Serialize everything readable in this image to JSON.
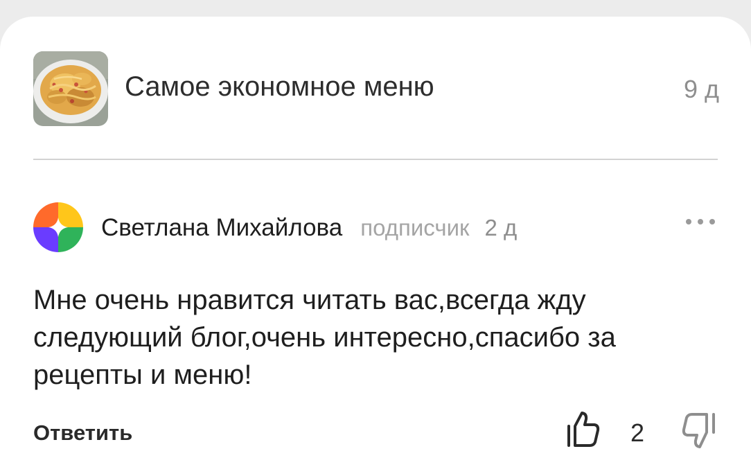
{
  "article": {
    "title": "Самое экономное меню",
    "age": "9 д"
  },
  "comment": {
    "author": "Светлана Михайлова",
    "role": "подписчик",
    "age": "2 д",
    "text": "Мне очень нравится читать вас,всегда жду следующий блог,очень интересно,спасибо за рецепты и меню!",
    "reply_label": "Ответить",
    "likes": "2"
  },
  "icons": {
    "more": "more-dots-icon",
    "like": "thumbs-up-icon",
    "dislike": "thumbs-down-icon"
  },
  "colors": {
    "avatar_orange": "#ff6a2b",
    "avatar_yellow": "#ffc61a",
    "avatar_purple": "#6a3cff",
    "avatar_green": "#2fb35a"
  }
}
